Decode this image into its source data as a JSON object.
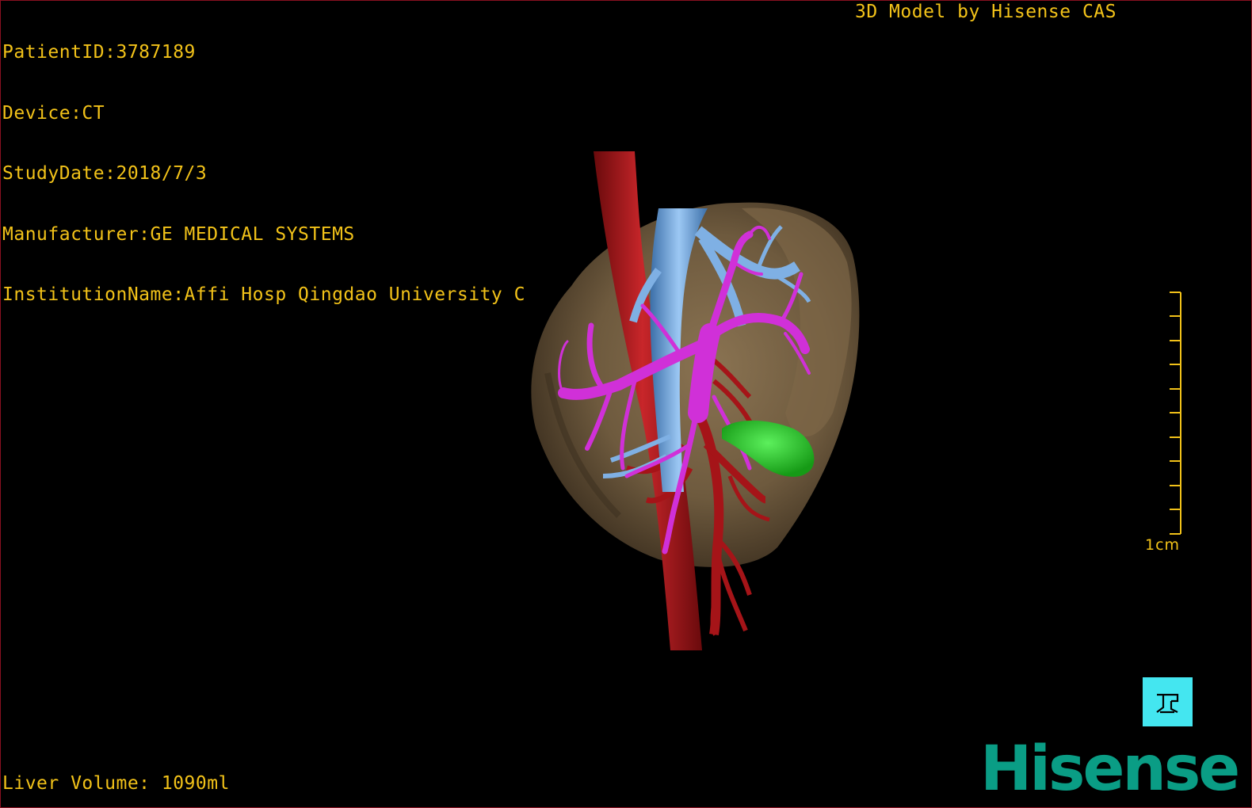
{
  "overlay": {
    "patient_id": "PatientID:3787189",
    "device": "Device:CT",
    "study_date": "StudyDate:2018/7/3",
    "manufacturer": "Manufacturer:GE MEDICAL SYSTEMS",
    "institution": "InstitutionName:Affi Hosp Qingdao University C",
    "credit": "3D Model by Hisense CAS",
    "liver_volume": "Liver Volume: 1090ml"
  },
  "scale_bar": {
    "label": "1cm"
  },
  "orientation_button": {
    "icon": "orientation-cube-icon"
  },
  "brand": {
    "logo_text": "Hisense"
  },
  "colors": {
    "overlay_text": "#f2c219",
    "liver": "#6e5a3e",
    "artery": "#b0181c",
    "vein": "#6aa4e0",
    "portal": "#d030d8",
    "gallbladder": "#28c828",
    "brand": "#0a9d85",
    "button": "#44e6f0"
  }
}
